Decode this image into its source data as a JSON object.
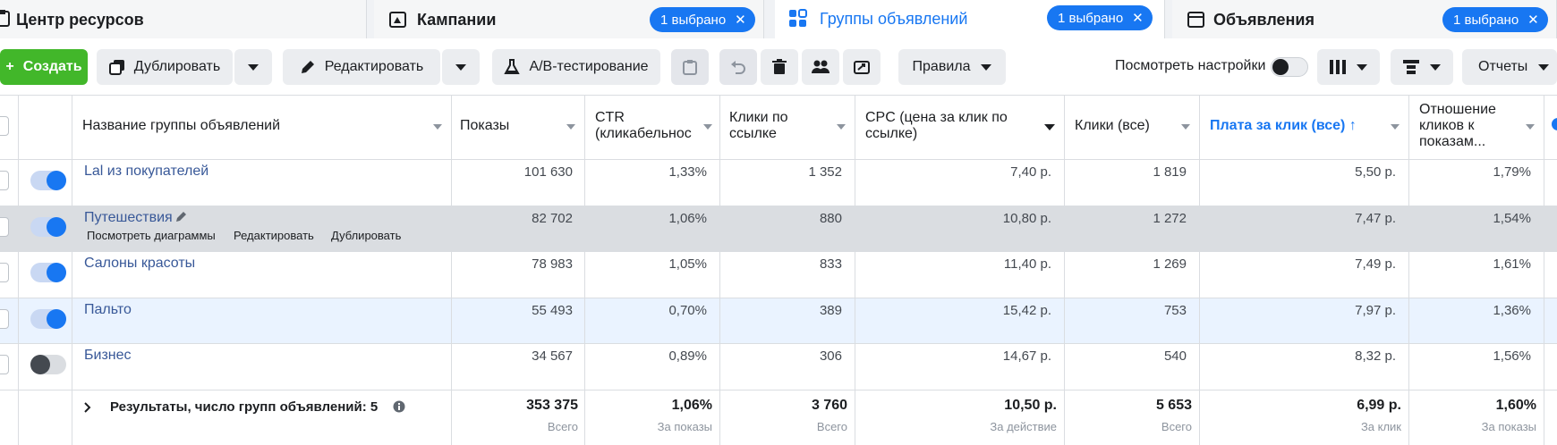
{
  "tabs": [
    {
      "label": "Центр ресурсов"
    },
    {
      "label": "Кампании",
      "badge": "1 выбрано"
    },
    {
      "label": "Группы объявлений",
      "badge": "1 выбрано"
    },
    {
      "label": "Объявления",
      "badge": "1 выбрано"
    }
  ],
  "toolbar": {
    "create": "Создать",
    "duplicate": "Дублировать",
    "edit": "Редактировать",
    "ab_test": "A/B-тестирование",
    "rules": "Правила",
    "view_settings": "Посмотреть настройки",
    "reports": "Отчеты"
  },
  "columns": {
    "name": "Название группы объявлений",
    "impressions": "Показы",
    "ctr_1": "CTR",
    "ctr_2": "(кликабельнос",
    "link_clicks_1": "Клики по",
    "link_clicks_2": "ссылке",
    "cpc_1": "CPC (цена за клик по",
    "cpc_2": "ссылке)",
    "clicks_all": "Клики (все)",
    "cpc_all": "Плата за клик (все) ↑",
    "ratio_1": "Отношение",
    "ratio_2": "кликов к",
    "ratio_3": "показам..."
  },
  "rows": [
    {
      "name": "Lal из покупателей",
      "active": true,
      "impressions": "101 630",
      "ctr": "1,33%",
      "link_clicks": "1 352",
      "cpc": "7,40 р.",
      "clicks_all": "1 819",
      "cpc_all": "5,50 р.",
      "ratio": "1,79%"
    },
    {
      "name": "Путешествия",
      "active": true,
      "impressions": "82 702",
      "ctr": "1,06%",
      "link_clicks": "880",
      "cpc": "10,80 р.",
      "clicks_all": "1 272",
      "cpc_all": "7,47 р.",
      "ratio": "1,54%"
    },
    {
      "name": "Салоны красоты",
      "active": true,
      "impressions": "78 983",
      "ctr": "1,05%",
      "link_clicks": "833",
      "cpc": "11,40 р.",
      "clicks_all": "1 269",
      "cpc_all": "7,49 р.",
      "ratio": "1,61%"
    },
    {
      "name": "Пальто",
      "active": true,
      "impressions": "55 493",
      "ctr": "0,70%",
      "link_clicks": "389",
      "cpc": "15,42 р.",
      "clicks_all": "753",
      "cpc_all": "7,97 р.",
      "ratio": "1,36%"
    },
    {
      "name": "Бизнес",
      "active": false,
      "impressions": "34 567",
      "ctr": "0,89%",
      "link_clicks": "306",
      "cpc": "14,67 р.",
      "clicks_all": "540",
      "cpc_all": "8,32 р.",
      "ratio": "1,56%"
    }
  ],
  "row_actions": {
    "view_charts": "Посмотреть диаграммы",
    "edit": "Редактировать",
    "duplicate": "Дублировать"
  },
  "totals": {
    "label": "Результаты, число групп объявлений: 5",
    "impressions": "353 375",
    "impressions_sub": "Всего",
    "ctr": "1,06%",
    "ctr_sub": "За показы",
    "link_clicks": "3 760",
    "link_clicks_sub": "Всего",
    "cpc": "10,50 р.",
    "cpc_sub": "За действие",
    "clicks_all": "5 653",
    "clicks_all_sub": "Всего",
    "cpc_all": "6,99 р.",
    "cpc_all_sub": "За клик",
    "ratio": "1,60%",
    "ratio_sub": "За показы"
  },
  "colors": {
    "accent": "#1877f2",
    "create": "#42b72a",
    "hover_row": "#dadde1",
    "selected_row": "#eaf3ff"
  }
}
